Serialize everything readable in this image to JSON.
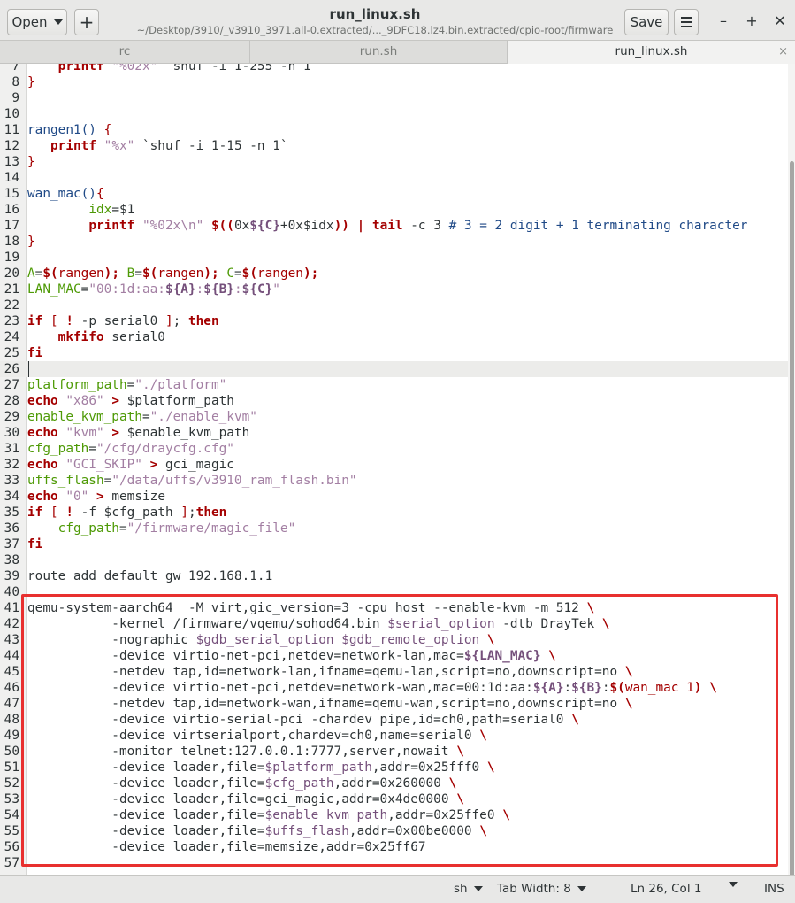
{
  "window": {
    "title": "run_linux.sh",
    "subtitle": "~/Desktop/3910/_v3910_3971.all-0.extracted/..._9DFC18.lz4.bin.extracted/cpio-root/firmware"
  },
  "toolbar": {
    "open_label": "Open",
    "new_label": "+",
    "save_label": "Save"
  },
  "window_controls": {
    "minimize": "–",
    "maximize": "+",
    "close": "✕"
  },
  "tabs": [
    {
      "label": "rc"
    },
    {
      "label": "run.sh"
    },
    {
      "label": "run_linux.sh",
      "active": true,
      "close": "×"
    }
  ],
  "editor": {
    "current_line": "26",
    "lines": [
      {
        "n": "7",
        "html": "    <span class=\"kw\">printf</span> <span class=\"str\">\"%02x\"</span> `shuf -i 1-255 -n 1`"
      },
      {
        "n": "8",
        "html": "<span class=\"par\">}</span>"
      },
      {
        "n": "9",
        "html": ""
      },
      {
        "n": "10",
        "html": ""
      },
      {
        "n": "11",
        "html": "<span class=\"fn\">rangen1()</span> <span class=\"par\">{</span>"
      },
      {
        "n": "12",
        "html": "   <span class=\"kw\">printf</span> <span class=\"str\">\"%x\"</span> `shuf -i 1-15 -n 1`"
      },
      {
        "n": "13",
        "html": "<span class=\"par\">}</span>"
      },
      {
        "n": "14",
        "html": ""
      },
      {
        "n": "15",
        "html": "<span class=\"fn\">wan_mac()</span><span class=\"par\">{</span>"
      },
      {
        "n": "16",
        "html": "        <span class=\"var\">idx</span>=$1"
      },
      {
        "n": "17",
        "html": "        <span class=\"kw\">printf</span> <span class=\"str\">\"%02x\\n\"</span> <span class=\"op\">$((</span>0x<span class=\"exp\">${C}</span>+0x$idx<span class=\"op\">))</span> <span class=\"op\">|</span> <span class=\"kw\">tail</span> -c 3 <span class=\"cmt\"># 3 = 2 digit + 1 terminating character</span>"
      },
      {
        "n": "18",
        "html": "<span class=\"par\">}</span>"
      },
      {
        "n": "19",
        "html": ""
      },
      {
        "n": "20",
        "html": "<span class=\"var\">A</span>=<span class=\"op\">$(</span><span class=\"par\">rangen</span><span class=\"op\">);</span> <span class=\"var\">B</span>=<span class=\"op\">$(</span><span class=\"par\">rangen</span><span class=\"op\">);</span> <span class=\"var\">C</span>=<span class=\"op\">$(</span><span class=\"par\">rangen</span><span class=\"op\">);</span>"
      },
      {
        "n": "21",
        "html": "<span class=\"var\">LAN_MAC</span>=<span class=\"str\">\"00:1d:aa:</span><span class=\"exp\">${A}</span><span class=\"str\">:</span><span class=\"exp\">${B}</span><span class=\"str\">:</span><span class=\"exp\">${C}</span><span class=\"str\">\"</span>"
      },
      {
        "n": "22",
        "html": ""
      },
      {
        "n": "23",
        "html": "<span class=\"kw\">if</span> <span class=\"par\">[</span> <span class=\"op\">!</span> -p serial0 <span class=\"par\">]</span>; <span class=\"kw\">then</span>"
      },
      {
        "n": "24",
        "html": "    <span class=\"kw\">mkfifo</span> serial0"
      },
      {
        "n": "25",
        "html": "<span class=\"kw\">fi</span>"
      },
      {
        "n": "26",
        "html": ""
      },
      {
        "n": "27",
        "html": "<span class=\"var\">platform_path</span>=<span class=\"str\">\"./platform\"</span>"
      },
      {
        "n": "28",
        "html": "<span class=\"kw\">echo</span> <span class=\"str\">\"x86\"</span> <span class=\"op\">&gt;</span> $platform_path"
      },
      {
        "n": "29",
        "html": "<span class=\"var\">enable_kvm_path</span>=<span class=\"str\">\"./enable_kvm\"</span>"
      },
      {
        "n": "30",
        "html": "<span class=\"kw\">echo</span> <span class=\"str\">\"kvm\"</span> <span class=\"op\">&gt;</span> $enable_kvm_path"
      },
      {
        "n": "31",
        "html": "<span class=\"var\">cfg_path</span>=<span class=\"str\">\"/cfg/draycfg.cfg\"</span>"
      },
      {
        "n": "32",
        "html": "<span class=\"kw\">echo</span> <span class=\"str\">\"GCI_SKIP\"</span> <span class=\"op\">&gt;</span> gci_magic"
      },
      {
        "n": "33",
        "html": "<span class=\"var\">uffs_flash</span>=<span class=\"str\">\"/data/uffs/v3910_ram_flash.bin\"</span>"
      },
      {
        "n": "34",
        "html": "<span class=\"kw\">echo</span> <span class=\"str\">\"0\"</span> <span class=\"op\">&gt;</span> memsize"
      },
      {
        "n": "35",
        "html": "<span class=\"kw\">if</span> <span class=\"par\">[</span> <span class=\"op\">!</span> -f $cfg_path <span class=\"par\">]</span>;<span class=\"kw\">then</span>"
      },
      {
        "n": "36",
        "html": "    <span class=\"var\">cfg_path</span>=<span class=\"str\">\"/firmware/magic_file\"</span>"
      },
      {
        "n": "37",
        "html": "<span class=\"kw\">fi</span>"
      },
      {
        "n": "38",
        "html": ""
      },
      {
        "n": "39",
        "html": "route add default gw 192.168.1.1"
      },
      {
        "n": "40",
        "html": ""
      },
      {
        "n": "41",
        "html": "qemu-system-aarch64  -M virt,gic_version=3 -cpu host --enable-kvm -m 512 <span class=\"op\">\\</span>"
      },
      {
        "n": "42",
        "html": "           -kernel /firmware/vqemu/sohod64.bin <span class=\"strd\">$serial_option</span> -dtb DrayTek <span class=\"op\">\\</span>"
      },
      {
        "n": "43",
        "html": "           -nographic <span class=\"strd\">$gdb_serial_option</span> <span class=\"strd\">$gdb_remote_option</span> <span class=\"op\">\\</span>"
      },
      {
        "n": "44",
        "html": "           -device virtio-net-pci,netdev=network-lan,mac=<span class=\"exp\">${LAN_MAC}</span> <span class=\"op\">\\</span>"
      },
      {
        "n": "45",
        "html": "           -netdev tap,id=network-lan,ifname=qemu-lan,script=no,downscript=no <span class=\"op\">\\</span>"
      },
      {
        "n": "46",
        "html": "           -device virtio-net-pci,netdev=network-wan,mac=00:1d:aa:<span class=\"exp\">${A}</span>:<span class=\"exp\">${B}</span>:<span class=\"op\">$(</span><span class=\"par\">wan_mac 1</span><span class=\"op\">)</span> <span class=\"op\">\\</span>"
      },
      {
        "n": "47",
        "html": "           -netdev tap,id=network-wan,ifname=qemu-wan,script=no,downscript=no <span class=\"op\">\\</span>"
      },
      {
        "n": "48",
        "html": "           -device virtio-serial-pci -chardev pipe,id=ch0,path=serial0 <span class=\"op\">\\</span>"
      },
      {
        "n": "49",
        "html": "           -device virtserialport,chardev=ch0,name=serial0 <span class=\"op\">\\</span>"
      },
      {
        "n": "50",
        "html": "           -monitor telnet:127.0.0.1:7777,server,nowait <span class=\"op\">\\</span>"
      },
      {
        "n": "51",
        "html": "           -device loader,file=<span class=\"strd\">$platform_path</span>,addr=0x25fff0 <span class=\"op\">\\</span>"
      },
      {
        "n": "52",
        "html": "           -device loader,file=<span class=\"strd\">$cfg_path</span>,addr=0x260000 <span class=\"op\">\\</span>"
      },
      {
        "n": "53",
        "html": "           -device loader,file=gci_magic,addr=0x4de0000 <span class=\"op\">\\</span>"
      },
      {
        "n": "54",
        "html": "           -device loader,file=<span class=\"strd\">$enable_kvm_path</span>,addr=0x25ffe0 <span class=\"op\">\\</span>"
      },
      {
        "n": "55",
        "html": "           -device loader,file=<span class=\"strd\">$uffs_flash</span>,addr=0x00be0000 <span class=\"op\">\\</span>"
      },
      {
        "n": "56",
        "html": "           -device loader,file=memsize,addr=0x25ff67"
      },
      {
        "n": "57",
        "html": ""
      }
    ]
  },
  "statusbar": {
    "language": "sh",
    "tab_width": "Tab Width: 8",
    "position": "Ln 26, Col 1",
    "mode": "INS"
  },
  "colors": {
    "highlight_box": "#e8302f",
    "keyword": "#a40000",
    "string": "#a37fa3",
    "variable": "#4e9a06",
    "function": "#204a87"
  }
}
